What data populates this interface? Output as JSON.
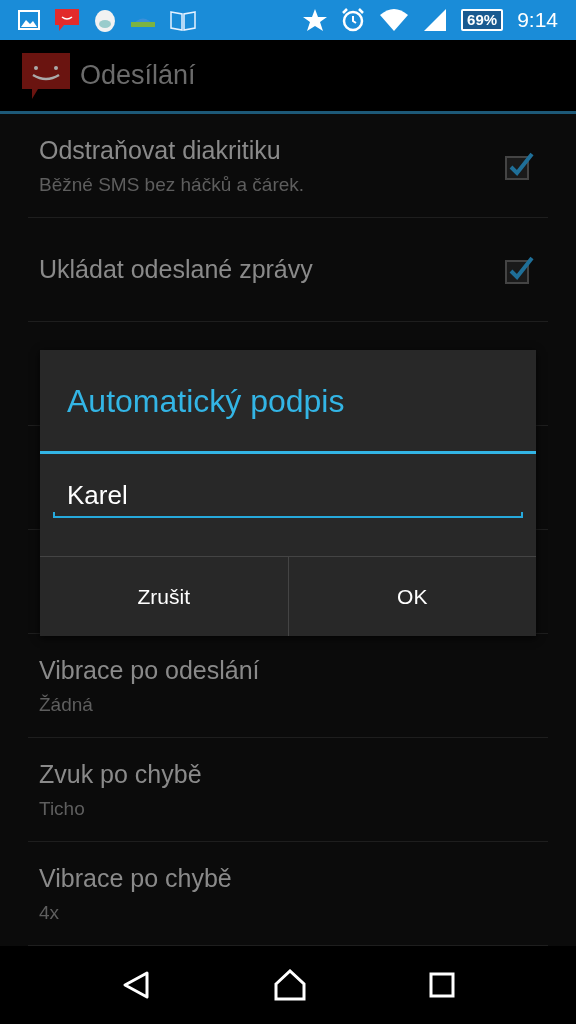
{
  "status_bar": {
    "battery": "69%",
    "time": "9:14"
  },
  "action_bar": {
    "title": "Odesílání"
  },
  "settings_top": [
    {
      "kind": "checkbox",
      "title": "Odstraňovat diakritiku",
      "summary": "Běžné SMS bez háčků a čárek.",
      "checked": true
    },
    {
      "kind": "checkbox",
      "title": "Ukládat odeslané zprávy",
      "checked": true
    }
  ],
  "settings_bottom": [
    {
      "title": "Vibrace po odeslání",
      "summary": "Žádná"
    },
    {
      "title": "Zvuk po chybě",
      "summary": "Ticho"
    },
    {
      "title": "Vibrace po chybě",
      "summary": "4x"
    }
  ],
  "dialog": {
    "title": "Automatický podpis",
    "value": "Karel",
    "buttons": [
      "Zrušit",
      "OK"
    ]
  }
}
